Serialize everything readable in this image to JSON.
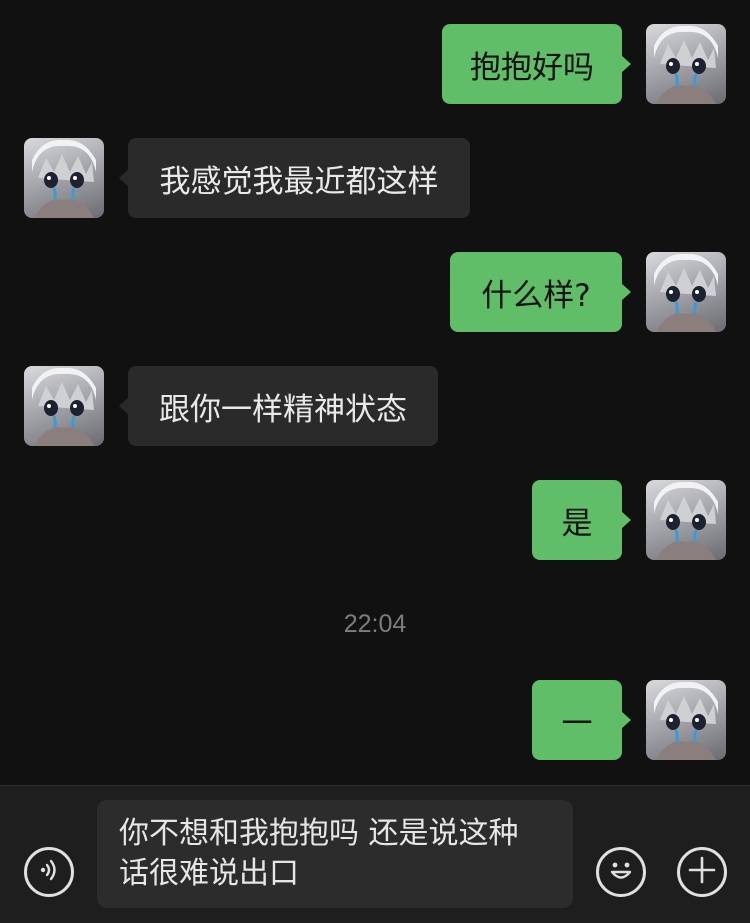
{
  "messages": [
    {
      "side": "me",
      "text": "抱抱好吗"
    },
    {
      "side": "other",
      "text": "我感觉我最近都这样"
    },
    {
      "side": "me",
      "text": "什么样?"
    },
    {
      "side": "other",
      "text": "跟你一样精神状态"
    },
    {
      "side": "me",
      "text": "是"
    },
    {
      "side": "me",
      "text": "一"
    }
  ],
  "timestamp": "22:04",
  "input": {
    "value": "你不想和我抱抱吗 还是说这种\n话很难说出口"
  },
  "icons": {
    "voice": "voice-icon",
    "emoji": "emoji-icon",
    "plus": "plus-icon"
  },
  "colors": {
    "background": "#111111",
    "my_bubble": "#5fbe67",
    "other_bubble": "#2a2a2a"
  }
}
